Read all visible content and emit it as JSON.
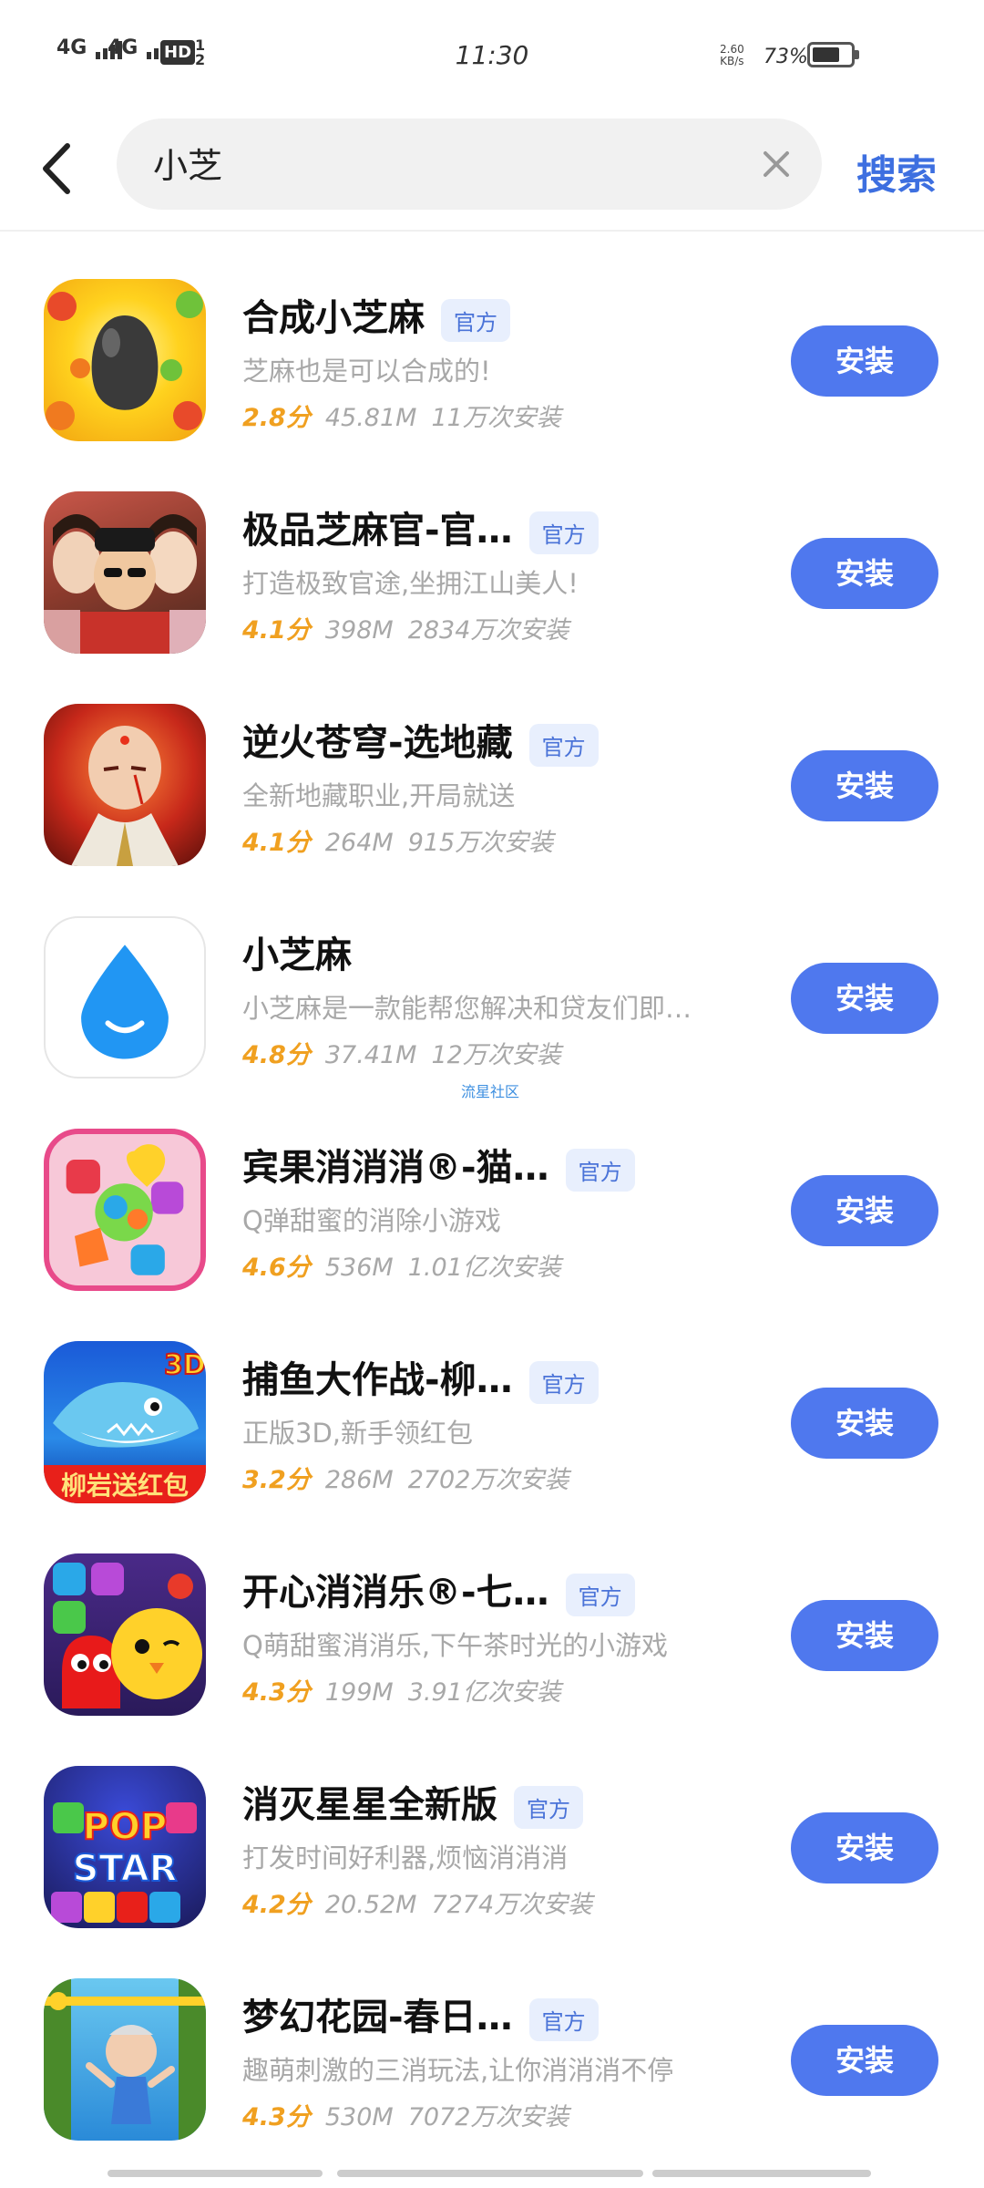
{
  "status_bar": {
    "signal_1": "4G",
    "signal_2": "4G",
    "hd": "HD",
    "hd_sub_top": "1",
    "hd_sub_bottom": "2",
    "time": "11:30",
    "net_speed_value": "2.60",
    "net_speed_unit": "KB/s",
    "battery_percent": "73%",
    "battery_level": 0.73
  },
  "search": {
    "query": "小芝",
    "button_label": "搜索"
  },
  "apps": [
    {
      "name": "合成小芝麻",
      "badge": "官方",
      "desc": "芝麻也是可以合成的!",
      "rating": "2.8分",
      "size": "45.81M",
      "installs": "11万次安装",
      "button": "安装"
    },
    {
      "name": "极品芝麻官-官…",
      "badge": "官方",
      "desc": "打造极致官途,坐拥江山美人!",
      "rating": "4.1分",
      "size": "398M",
      "installs": "2834万次安装",
      "button": "安装"
    },
    {
      "name": "逆火苍穹-选地藏",
      "badge": "官方",
      "desc": "全新地藏职业,开局就送",
      "rating": "4.1分",
      "size": "264M",
      "installs": "915万次安装",
      "button": "安装"
    },
    {
      "name": "小芝麻",
      "badge": "",
      "desc": "小芝麻是一款能帮您解决和贷友们即…",
      "rating": "4.8分",
      "size": "37.41M",
      "installs": "12万次安装",
      "button": "安装"
    },
    {
      "name": "宾果消消消®-猫…",
      "badge": "官方",
      "desc": "Q弹甜蜜的消除小游戏",
      "rating": "4.6分",
      "size": "536M",
      "installs": "1.01亿次安装",
      "button": "安装"
    },
    {
      "name": "捕鱼大作战-柳…",
      "badge": "官方",
      "desc": "正版3D,新手领红包",
      "rating": "3.2分",
      "size": "286M",
      "installs": "2702万次安装",
      "button": "安装"
    },
    {
      "name": "开心消消乐®-七…",
      "badge": "官方",
      "desc": "Q萌甜蜜消消乐,下午茶时光的小游戏",
      "rating": "4.3分",
      "size": "199M",
      "installs": "3.91亿次安装",
      "button": "安装"
    },
    {
      "name": "消灭星星全新版",
      "badge": "官方",
      "desc": "打发时间好利器,烦恼消消消",
      "rating": "4.2分",
      "size": "20.52M",
      "installs": "7274万次安装",
      "button": "安装"
    },
    {
      "name": "梦幻花园-春日…",
      "badge": "官方",
      "desc": "趣萌刺激的三消玩法,让你消消消不停",
      "rating": "4.3分",
      "size": "530M",
      "installs": "7072万次安装",
      "button": "安装"
    }
  ],
  "icon_text": {
    "fish_badge": "3D",
    "fish_banner": "柳岩送红包",
    "popstar_top": "POP",
    "popstar_bottom": "STAR"
  },
  "watermark": "流星社区"
}
